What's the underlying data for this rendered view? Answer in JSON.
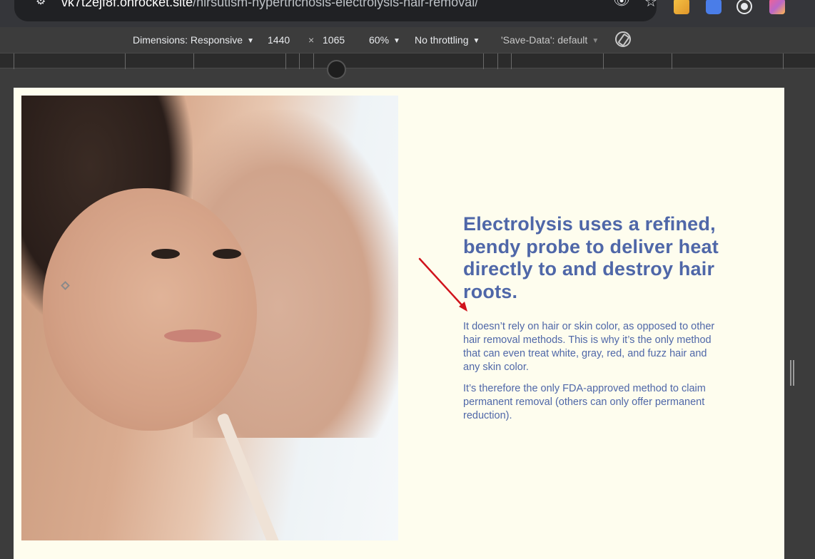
{
  "browser": {
    "url_host": "vk7t2ejf8f.onrocket.site",
    "url_path": "/hirsutism-hypertrichosis-electrolysis-hair-removal/",
    "site_info_icon": "tune-icon",
    "eye_icon": "eye-off-icon",
    "star_icon": "star-icon"
  },
  "device_toolbar": {
    "dimensions_label": "Dimensions: Responsive",
    "width": "1440",
    "times": "×",
    "height": "1065",
    "zoom": "60%",
    "throttling": "No throttling",
    "save_data": "'Save-Data': default"
  },
  "page": {
    "headline": "Electrolysis uses a refined, bendy probe to deliver heat directly to and destroy hair roots.",
    "paragraph1": "It doesn’t rely on hair or skin color, as opposed to other hair removal methods. This is why it’s the only method that can even treat white, gray, red, and fuzz hair and any skin color.",
    "paragraph2": "It’s therefore the only FDA-approved method to claim permanent removal (others can only offer permanent reduction).",
    "text_color": "#4f67a8",
    "background_color": "#fefdee",
    "annotation_color": "#d0131b"
  }
}
